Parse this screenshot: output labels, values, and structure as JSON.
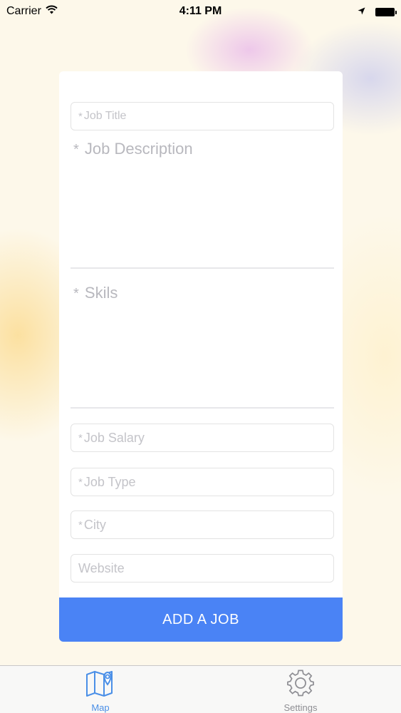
{
  "status_bar": {
    "carrier": "Carrier",
    "time": "4:11 PM"
  },
  "form": {
    "job_title": {
      "star": "*",
      "placeholder": "Job Title",
      "value": ""
    },
    "job_description": {
      "star": "*",
      "placeholder": "Job Description",
      "value": ""
    },
    "skills": {
      "star": "*",
      "placeholder": "Skils",
      "value": ""
    },
    "job_salary": {
      "star": "*",
      "placeholder": "Job Salary",
      "value": ""
    },
    "job_type": {
      "star": "*",
      "placeholder": "Job Type",
      "value": ""
    },
    "city": {
      "star": "*",
      "placeholder": "City",
      "value": ""
    },
    "website": {
      "placeholder": "Website",
      "value": ""
    },
    "submit_label": "ADD A JOB"
  },
  "tab_bar": {
    "tabs": [
      {
        "label": "Map",
        "icon": "map-icon",
        "selected": true
      },
      {
        "label": "Settings",
        "icon": "gear-icon",
        "selected": false
      }
    ]
  },
  "colors": {
    "accent": "#4a83f5",
    "tab_selected": "#4a8fe7",
    "tab_unselected": "#8e8e93",
    "placeholder": "#c4c4c9"
  }
}
